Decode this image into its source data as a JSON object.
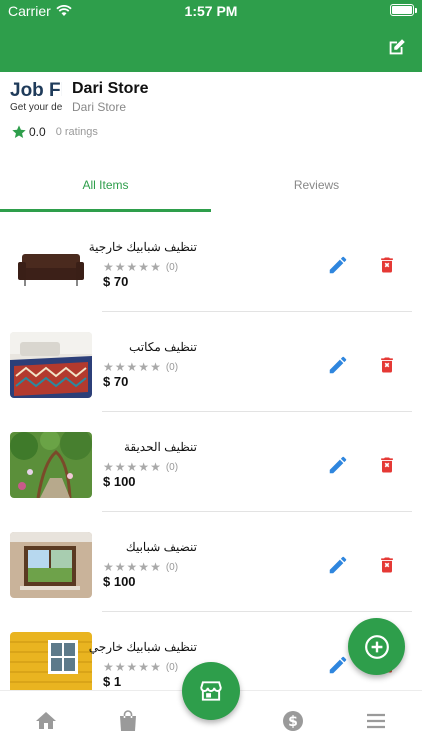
{
  "status_bar": {
    "carrier": "Carrier",
    "time": "1:57 PM"
  },
  "header": {
    "edit_icon": "edit-square-icon",
    "bar_color": "#2e9e4b"
  },
  "store": {
    "logo_title": "Job Fl",
    "logo_subtitle": "Get your de",
    "name": "Dari Store",
    "subtitle": "Dari Store",
    "rating": "0.0",
    "ratings_count": "0 ratings"
  },
  "tabs": [
    {
      "label": "All Items",
      "active": true
    },
    {
      "label": "Reviews",
      "active": false
    }
  ],
  "items": [
    {
      "name": "تنظيف شبابيك خارجية",
      "reviews": "(0)",
      "price": "$ 70",
      "image": "sofa"
    },
    {
      "name": "تنظيف مكاتب",
      "reviews": "(0)",
      "price": "$ 70",
      "image": "living-room"
    },
    {
      "name": "تنظيف الحديقة",
      "reviews": "(0)",
      "price": "$ 100",
      "image": "garden"
    },
    {
      "name": "تنضيف شبابيك",
      "reviews": "(0)",
      "price": "$ 100",
      "image": "window"
    },
    {
      "name": "تنظيف شبابيك خارجي",
      "reviews": "(0)",
      "price": "$ 1",
      "image": "yellow-house"
    }
  ],
  "colors": {
    "accent": "#2e9e4b",
    "edit": "#2f86de",
    "delete": "#e53935",
    "star_empty": "#a9a9a9"
  },
  "bottom_nav": [
    {
      "icon": "home-icon"
    },
    {
      "icon": "shopping-bag-icon"
    },
    {
      "icon": "storefront-icon"
    },
    {
      "icon": "dollar-icon"
    },
    {
      "icon": "menu-icon"
    }
  ]
}
